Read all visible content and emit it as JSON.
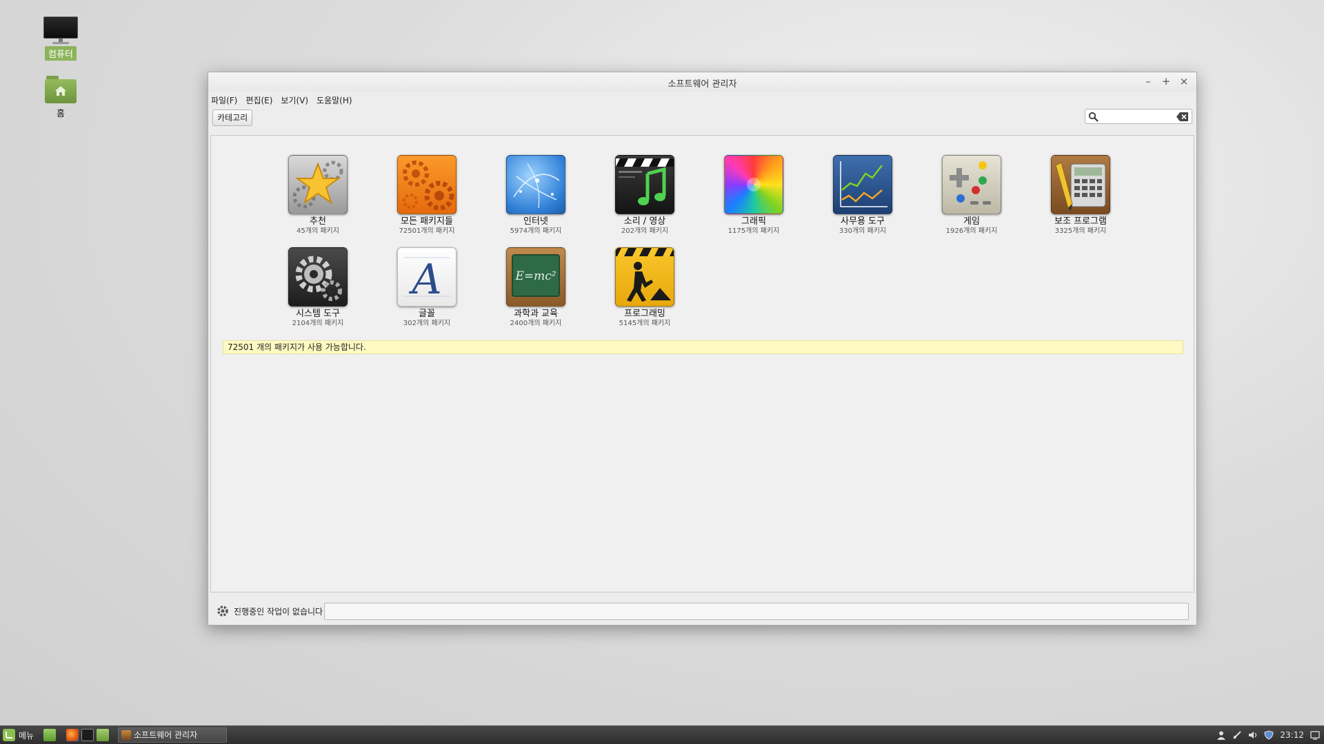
{
  "desktop": {
    "computer_label": "컴퓨터",
    "home_label": "홈"
  },
  "window": {
    "title": "소프트웨어 관리자",
    "controls": {
      "minimize": "–",
      "maximize": "+",
      "close": "×"
    },
    "menu": [
      "파일(F)",
      "편집(E)",
      "보기(V)",
      "도움말(H)"
    ],
    "toolbar": {
      "category_button": "카테고리",
      "search_placeholder": ""
    },
    "categories": [
      {
        "name": "추천",
        "count": "45개의 패키지",
        "icon": "star-icon"
      },
      {
        "name": "모든 패키지들",
        "count": "72501개의 패키지",
        "icon": "gears-icon"
      },
      {
        "name": "인터넷",
        "count": "5974개의 패키지",
        "icon": "globe-icon"
      },
      {
        "name": "소리 / 영상",
        "count": "202개의 패키지",
        "icon": "clapper-music-icon"
      },
      {
        "name": "그래픽",
        "count": "1175개의 패키지",
        "icon": "color-wheel-icon"
      },
      {
        "name": "사무용 도구",
        "count": "330개의 패키지",
        "icon": "line-chart-icon"
      },
      {
        "name": "게임",
        "count": "1926개의 패키지",
        "icon": "gamepad-icon"
      },
      {
        "name": "보조 프로그램",
        "count": "3325개의 패키지",
        "icon": "calculator-icon"
      },
      {
        "name": "시스템 도구",
        "count": "2104개의 패키지",
        "icon": "system-gear-icon"
      },
      {
        "name": "글꼴",
        "count": "302개의 패키지",
        "icon": "font-icon"
      },
      {
        "name": "과학과 교육",
        "count": "2400개의 패키지",
        "icon": "chalkboard-icon"
      },
      {
        "name": "프로그래밍",
        "count": "5145개의 패키지",
        "icon": "construction-icon"
      }
    ],
    "info_text": "72501 개의 패키지가 사용 가능합니다.",
    "status_text": "진행중인 작업이 없습니다"
  },
  "taskbar": {
    "menu_label": "메뉴",
    "task_label": "소프트웨어 관리자",
    "clock": "23:12"
  }
}
